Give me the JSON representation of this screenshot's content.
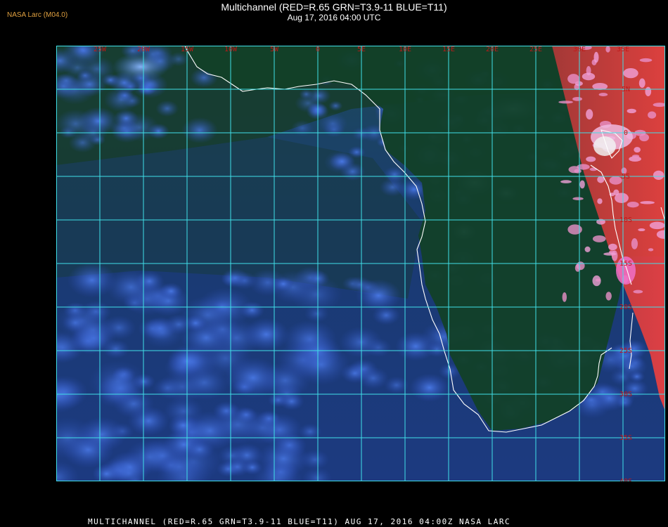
{
  "header": {
    "credit": "NASA Larc (M04.0)",
    "title": "Multichannel (RED=R.65 GRN=T3.9-11 BLUE=T11)",
    "subtitle": "Aug 17, 2016 04:00 UTC"
  },
  "footer": {
    "caption": "MULTICHANNEL (RED=R.65 GRN=T3.9-11 BLUE=T11) AUG 17, 2016 04:00Z   NASA LARC"
  },
  "grid": {
    "line_color": "#40e0e8",
    "label_color": "#c01818",
    "longitude_labels": [
      "25W",
      "20W",
      "15W",
      "10W",
      "5W",
      "0",
      "5E",
      "10E",
      "15E",
      "20E",
      "25E",
      "30E",
      "35E"
    ],
    "latitude_labels": [
      "5N",
      "0",
      "5S",
      "10S",
      "15S",
      "20S",
      "25S",
      "30S",
      "35S",
      "40S"
    ]
  },
  "colors": {
    "ocean": "#1a3a6a",
    "land_dark": "#123a22",
    "cloud": "#3060d0",
    "hot_land": "#e04040",
    "coastline": "#ffffff"
  }
}
